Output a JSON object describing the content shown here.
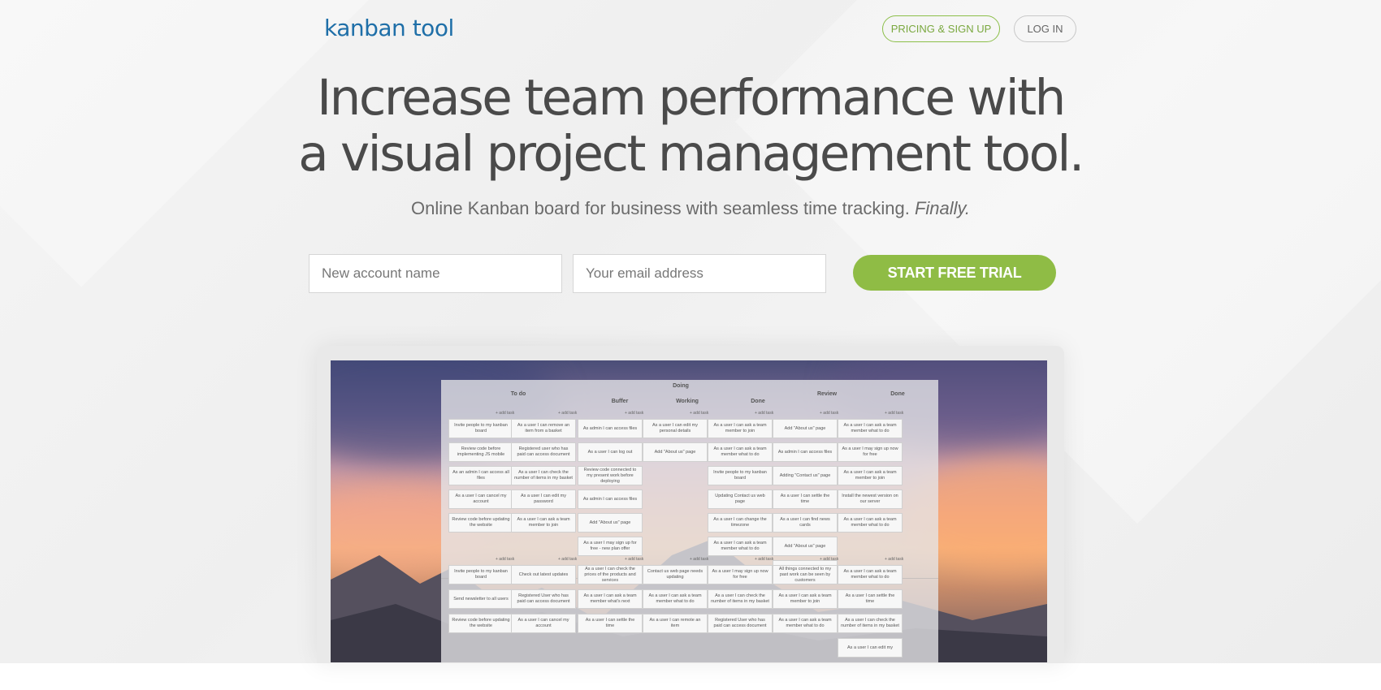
{
  "header": {
    "logo": "kanban tool",
    "pricing_label": "PRICING & SIGN UP",
    "login_label": "LOG IN"
  },
  "hero": {
    "headline_line1": "Increase team performance with",
    "headline_line2": "a visual project management tool.",
    "subline_text": "Online Kanban board for business with seamless time tracking.",
    "subline_emphasis": "Finally."
  },
  "signup": {
    "account_placeholder": "New account name",
    "email_placeholder": "Your email address",
    "cta_label": "START FREE TRIAL"
  },
  "board": {
    "columns": {
      "todo": "To do",
      "doing": "Doing",
      "buffer": "Buffer",
      "working": "Working",
      "done1": "Done",
      "review": "Review",
      "done2": "Done"
    },
    "add_task": "+ add task",
    "cards": [
      "Invite people to my kanban board",
      "Review code before implementing JS mobile",
      "As an admin I can access all files",
      "As a user I can cancel my account",
      "Review code before updating the website",
      "As a user I can remove an item from a basket",
      "Registered user who has paid can access document",
      "As a user I can check the number of items in my basket",
      "As a user I can edit my password",
      "As a user I can ask a team member to join",
      "As admin I can access files",
      "As a user I can log out",
      "Review code connected to my present work before deploying",
      "As admin I can access files",
      "Add \"About us\" page",
      "As a user I may sign up for free - new plan offer",
      "As a user I can edit my personal details",
      "Add \"About us\" page",
      "As a user I can ask a team member to join",
      "As a user I can ask a team member what to do",
      "Invite people to my kanban board",
      "Updating Contact us web page",
      "As a user I can change the timezone",
      "As a user I can ask a team member what to do",
      "Add \"About us\" page",
      "As admin I can access files",
      "Adding \"Contact us\" page",
      "As a user I can settle the time",
      "As a user I can find news cards",
      "Add \"About us\" page",
      "As admin I can access files",
      "As a user I can ask a team member what to do",
      "As a user I may sign up now for free",
      "As a user I can ask a team member to join",
      "Install the newest version on our server",
      "As a user I can ask a team member what to do",
      "Invite people to my kanban board",
      "Send newsletter to all users",
      "Review code before updating the website",
      "Check out latest updates",
      "Registered User who has paid can access document",
      "As a user I can cancel my account",
      "As a user I can check the prices of the products and services",
      "As a user I can ask a team member what's next",
      "As a user I can settle the time",
      "Contact us web page needs updating",
      "As a user I can ask a team member what to do",
      "As a user I can remote an item",
      "As a user I may sign up now for free",
      "As a user I can check the number of items in my basket",
      "Registered User who has paid can access document",
      "All things connected to my past work can be seen by customers",
      "As a user I can ask a team member to join",
      "As a user I can ask a team member what to do",
      "As a user I can ask a team member what to do",
      "As a user I can settle the time",
      "As a user I can check the number of items in my basket",
      "As a user I can edit my"
    ]
  },
  "colors": {
    "brand_blue": "#1f6fa8",
    "accent_green": "#8fbc45"
  }
}
